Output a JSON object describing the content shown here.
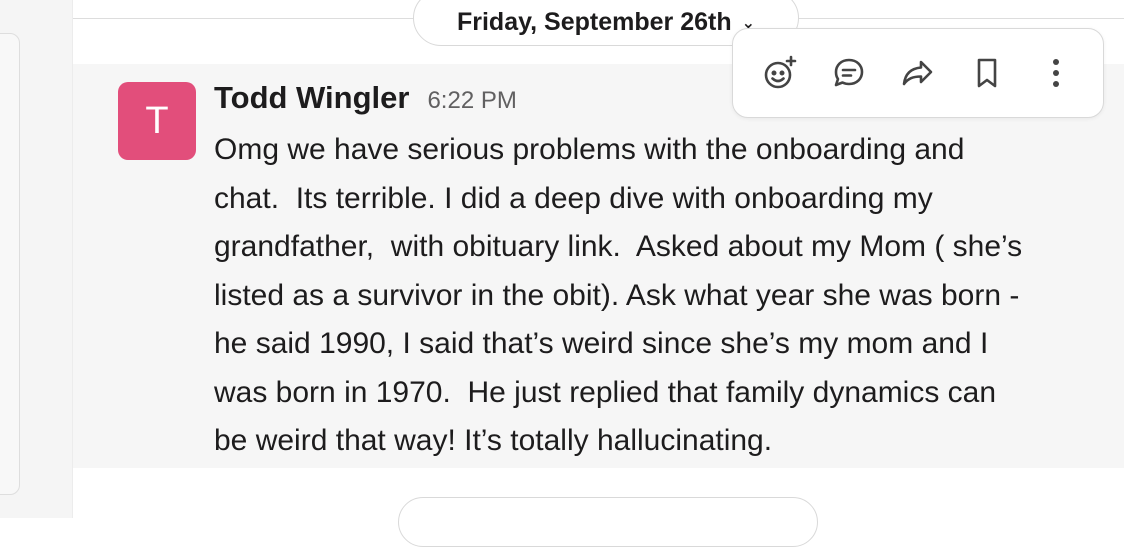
{
  "date_divider": {
    "label": "Friday, September 26th"
  },
  "message": {
    "avatar_letter": "T",
    "sender": "Todd Wingler",
    "time": "6:22 PM",
    "text": "Omg we have serious problems with the onboarding and\nchat.  Its terrible. I did a deep dive with onboarding my\ngrandfather,  with obituary link.  Asked about my Mom ( she’s\nlisted as a survivor in the obit). Ask what year she was born -\nhe said 1990, I said that’s weird since she’s my mom and I\nwas born in 1970.  He just replied that family dynamics can\nbe weird that way! It’s totally hallucinating."
  },
  "toolbar": {
    "icons": [
      "add-reaction-icon",
      "reply-in-thread-icon",
      "forward-icon",
      "save-bookmark-icon",
      "more-actions-icon"
    ]
  },
  "colors": {
    "avatar_bg": "#e24e7b",
    "row_hover_bg": "#f6f6f6",
    "border": "#d9d9d9",
    "text": "#1d1c1d",
    "muted": "#616061"
  }
}
